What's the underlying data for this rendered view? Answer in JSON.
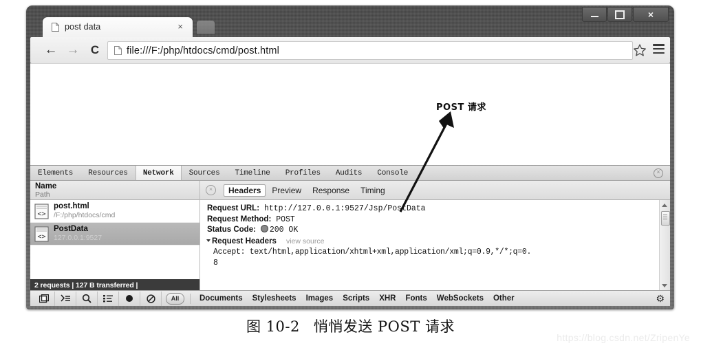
{
  "browser": {
    "tab": {
      "title": "post data",
      "close_label": "×",
      "favicon": "page-icon"
    },
    "window_controls": {
      "minimize": "minimize",
      "maximize": "maximize",
      "close": "×"
    },
    "toolbar": {
      "back": "←",
      "forward": "→",
      "reload": "C",
      "url": "file:///F:/php/htdocs/cmd/post.html",
      "star": "bookmark-star",
      "menu": "hamburger-menu"
    }
  },
  "devtools": {
    "tabs": [
      {
        "label": "Elements",
        "active": false
      },
      {
        "label": "Resources",
        "active": false
      },
      {
        "label": "Network",
        "active": true
      },
      {
        "label": "Sources",
        "active": false
      },
      {
        "label": "Timeline",
        "active": false
      },
      {
        "label": "Profiles",
        "active": false
      },
      {
        "label": "Audits",
        "active": false
      },
      {
        "label": "Console",
        "active": false
      }
    ],
    "close_button": "×",
    "network": {
      "column_header": {
        "name": "Name",
        "path": "Path"
      },
      "requests": [
        {
          "name": "post.html",
          "path": "/F:/php/htdocs/cmd",
          "selected": false
        },
        {
          "name": "PostData",
          "path": "127.0.0.1:9527",
          "selected": true
        }
      ],
      "status_bar": "2 requests | 127 B transferred |"
    },
    "detail": {
      "close_button": "×",
      "subtabs": [
        {
          "label": "Headers",
          "active": true
        },
        {
          "label": "Preview",
          "active": false
        },
        {
          "label": "Response",
          "active": false
        },
        {
          "label": "Timing",
          "active": false
        }
      ],
      "request_url_key": "Request URL:",
      "request_url_value": "http://127.0.0.1:9527/Jsp/PostData",
      "request_method_key": "Request Method:",
      "request_method_value": "POST",
      "status_code_key": "Status Code:",
      "status_code_value": "200 OK",
      "request_headers_title": "Request Headers",
      "view_source": "view source",
      "accept_line1": "Accept: text/html,application/xhtml+xml,application/xml;q=0.9,*/*;q=0.",
      "accept_line2": "8"
    },
    "filter_bar": {
      "icons": [
        {
          "name": "dock-panel-icon",
          "glyph": "⧉"
        },
        {
          "name": "console-drawer-icon",
          "glyph": "⌫"
        },
        {
          "name": "search-icon",
          "glyph": "⌕"
        },
        {
          "name": "list-filter-icon",
          "glyph": "≣"
        },
        {
          "name": "record-icon",
          "glyph": "●"
        },
        {
          "name": "clear-icon",
          "glyph": "⊘"
        }
      ],
      "all_label": "All",
      "types": [
        "Documents",
        "Stylesheets",
        "Images",
        "Scripts",
        "XHR",
        "Fonts",
        "WebSockets",
        "Other"
      ],
      "settings": "⚙"
    }
  },
  "annotation": {
    "label": "POST 请求"
  },
  "caption": {
    "figure_number": "图 10-2",
    "text": "悄悄发送 POST 请求"
  },
  "watermark": {
    "text": "https://blog.csdn.net/ZripenYe"
  }
}
